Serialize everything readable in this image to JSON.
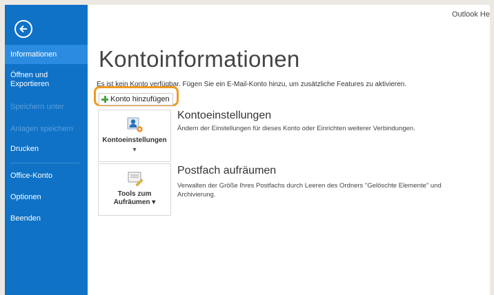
{
  "window": {
    "user_label": "Outlook He"
  },
  "sidebar": {
    "back_label": "Zurück",
    "items": [
      {
        "label": "Informationen"
      },
      {
        "label": "Öffnen und\nExportieren"
      },
      {
        "label": "Speichern unter"
      },
      {
        "label": "Anlagen speichern"
      },
      {
        "label": "Drucken"
      },
      {
        "label": "Office-Konto"
      },
      {
        "label": "Optionen"
      },
      {
        "label": "Beenden"
      }
    ]
  },
  "main": {
    "title": "Kontoinformationen",
    "info_text": "Es ist kein Konto verfügbar. Fügen Sie ein E-Mail-Konto hinzu, um zusätzliche Features zu aktivieren.",
    "add_account_label": "Konto hinzufügen",
    "sections": [
      {
        "tile_label": "Kontoeinstellungen",
        "tile_sub": "▾",
        "heading": "Kontoeinstellungen",
        "description": "Ändern der Einstellungen für dieses Konto oder Einrichten weiterer Verbindungen."
      },
      {
        "tile_label": "Tools zum\nAufräumen ▾",
        "tile_sub": "",
        "heading": "Postfach aufräumen",
        "description": "Verwalten der Größe Ihres Postfachs durch Leeren des Ordners \"Gelöschte Elemente\" und Archivierung."
      }
    ]
  },
  "colors": {
    "sidebar_bg": "#0f72c6",
    "sidebar_active": "#2b8be0",
    "highlight_outline": "#f09a1f",
    "plus_icon": "#4aa14a"
  }
}
